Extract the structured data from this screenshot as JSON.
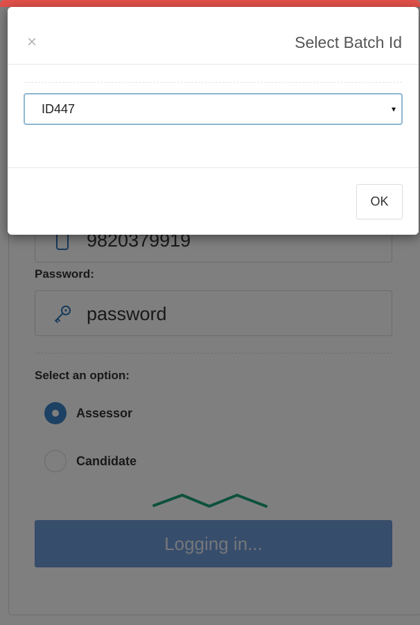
{
  "background_page": {
    "phone_value": "9820379919",
    "password_label": "Password:",
    "password_value": "password",
    "option_label": "Select an option:",
    "options": [
      {
        "label": "Assessor",
        "selected": true
      },
      {
        "label": "Candidate",
        "selected": false
      }
    ],
    "login_button_label": "Logging in...",
    "icons": {
      "phone": "phone-icon",
      "password": "key-icon"
    },
    "colors": {
      "primary_button": "#6f9ad8",
      "radio_selected": "#3a83c6",
      "spinner": "#1aa37a"
    }
  },
  "modal": {
    "title": "Select Batch Id",
    "close_symbol": "×",
    "batch_select": {
      "selected_value": "ID447",
      "arrow": "▾"
    },
    "ok_label": "OK",
    "accent_color": "#e2504a"
  }
}
